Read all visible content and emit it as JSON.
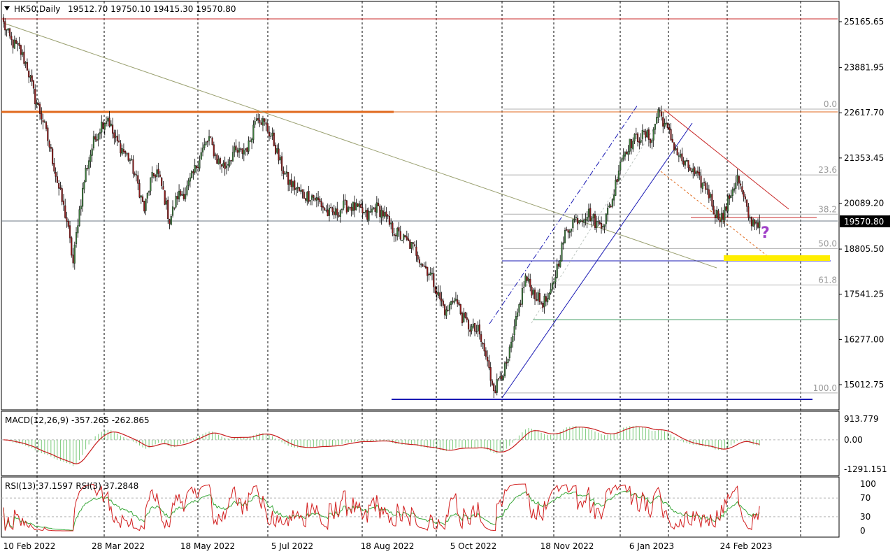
{
  "chart_data": {
    "type": "candlestick",
    "main": {
      "symbol_label": "HK50,Daily",
      "ohlc_label": "19512.70 19750.10 19415.30 19570.80",
      "current_price": "19570.80",
      "y_ticks": [
        "25165.65",
        "23881.95",
        "22617.70",
        "21353.45",
        "20089.20",
        "18805.50",
        "17541.25",
        "16277.00",
        "15012.75"
      ],
      "y_tick_values": [
        25165.65,
        23881.95,
        22617.7,
        21353.45,
        20089.2,
        18805.5,
        17541.25,
        16277.0,
        15012.75
      ],
      "fib_levels": [
        {
          "label": "0.0",
          "value": 22720
        },
        {
          "label": "23.6",
          "value": 20880
        },
        {
          "label": "38.2",
          "value": 19780
        },
        {
          "label": "50.0",
          "value": 18820
        },
        {
          "label": "61.8",
          "value": 17800
        },
        {
          "label": "100.0",
          "value": 14780
        }
      ],
      "annotation": "?"
    },
    "x_ticks": [
      "10 Feb 2022",
      "28 Mar 2022",
      "18 May 2022",
      "5 Jul 2022",
      "18 Aug 2022",
      "5 Oct 2022",
      "18 Nov 2022",
      "6 Jan 2023",
      "24 Feb 2023"
    ],
    "macd": {
      "label": "MACD(12,26,9) -357.265 -262.865",
      "y_ticks": [
        "913.779",
        "0.00",
        "-1291.151"
      ],
      "y_tick_values": [
        913.779,
        0,
        -1291.151
      ]
    },
    "rsi": {
      "label": "RSI(13) 37.1597  RSI(3) 37.2848",
      "y_ticks": [
        "100",
        "70",
        "30",
        "0"
      ],
      "y_tick_values": [
        100,
        70,
        30,
        0
      ]
    },
    "colors": {
      "bull": "#3c7a3c",
      "bear": "#8b1a1a",
      "orange_line": "#e06a1e",
      "red_line": "#c82828",
      "blue_line": "#1a1ab4",
      "green_line": "#4aa06a",
      "yellow_zone": "#ffee00",
      "macd_hist": "#7ccb7c",
      "macd_signal": "#c81e1e",
      "rsi_fast": "#d21e1e",
      "rsi_slow": "#3aa83a",
      "qmark": "#a040c8"
    },
    "series_anchors": [
      [
        0,
        25100
      ],
      [
        5,
        24600
      ],
      [
        10,
        24400
      ],
      [
        15,
        23900
      ],
      [
        20,
        23000
      ],
      [
        25,
        22400
      ],
      [
        30,
        21500
      ],
      [
        35,
        20500
      ],
      [
        40,
        19600
      ],
      [
        44,
        18400
      ],
      [
        47,
        19600
      ],
      [
        52,
        21000
      ],
      [
        57,
        21800
      ],
      [
        62,
        22300
      ],
      [
        66,
        22500
      ],
      [
        70,
        21900
      ],
      [
        75,
        21600
      ],
      [
        80,
        21300
      ],
      [
        85,
        20600
      ],
      [
        89,
        19900
      ],
      [
        93,
        20700
      ],
      [
        97,
        21000
      ],
      [
        101,
        20400
      ],
      [
        105,
        19600
      ],
      [
        110,
        20300
      ],
      [
        115,
        20400
      ],
      [
        120,
        20900
      ],
      [
        125,
        21500
      ],
      [
        130,
        21900
      ],
      [
        135,
        21300
      ],
      [
        140,
        21100
      ],
      [
        145,
        21500
      ],
      [
        150,
        21500
      ],
      [
        155,
        21700
      ],
      [
        160,
        22600
      ],
      [
        165,
        22300
      ],
      [
        170,
        21900
      ],
      [
        175,
        21200
      ],
      [
        180,
        20700
      ],
      [
        185,
        20500
      ],
      [
        190,
        20300
      ],
      [
        195,
        20300
      ],
      [
        200,
        20100
      ],
      [
        205,
        19800
      ],
      [
        210,
        19800
      ],
      [
        215,
        20000
      ],
      [
        220,
        20000
      ],
      [
        225,
        19900
      ],
      [
        230,
        19700
      ],
      [
        235,
        20000
      ],
      [
        240,
        19800
      ],
      [
        245,
        19400
      ],
      [
        250,
        19200
      ],
      [
        255,
        19000
      ],
      [
        260,
        18800
      ],
      [
        265,
        18400
      ],
      [
        270,
        18100
      ],
      [
        275,
        17500
      ],
      [
        280,
        17000
      ],
      [
        285,
        17500
      ],
      [
        290,
        16900
      ],
      [
        295,
        16600
      ],
      [
        300,
        16500
      ],
      [
        305,
        15800
      ],
      [
        308,
        15200
      ],
      [
        311,
        14900
      ],
      [
        314,
        15300
      ],
      [
        318,
        15500
      ],
      [
        322,
        16300
      ],
      [
        326,
        17200
      ],
      [
        330,
        18000
      ],
      [
        335,
        17600
      ],
      [
        340,
        17300
      ],
      [
        345,
        17400
      ],
      [
        350,
        18300
      ],
      [
        355,
        19200
      ],
      [
        360,
        19600
      ],
      [
        365,
        19700
      ],
      [
        370,
        19800
      ],
      [
        375,
        19500
      ],
      [
        380,
        19600
      ],
      [
        385,
        20200
      ],
      [
        390,
        21300
      ],
      [
        395,
        21700
      ],
      [
        400,
        21900
      ],
      [
        405,
        22000
      ],
      [
        410,
        21900
      ],
      [
        414,
        22720
      ],
      [
        418,
        22300
      ],
      [
        422,
        21900
      ],
      [
        426,
        21500
      ],
      [
        430,
        21200
      ],
      [
        435,
        21000
      ],
      [
        440,
        20700
      ],
      [
        445,
        20500
      ],
      [
        450,
        19800
      ],
      [
        455,
        19700
      ],
      [
        460,
        20400
      ],
      [
        464,
        20800
      ],
      [
        468,
        20200
      ],
      [
        472,
        19600
      ],
      [
        478,
        19570
      ]
    ]
  }
}
